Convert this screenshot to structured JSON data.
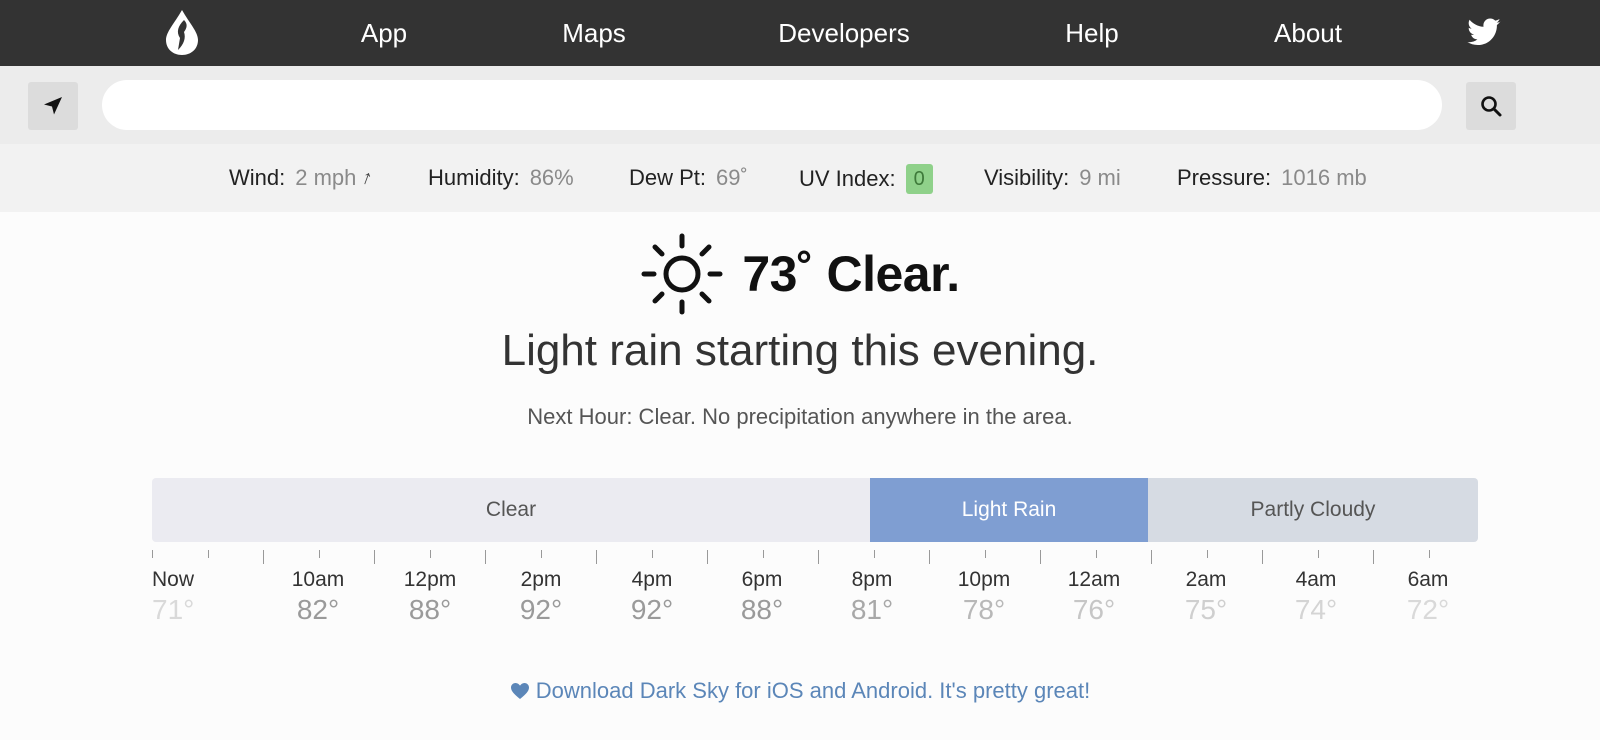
{
  "nav": {
    "logo": "logo-icon",
    "links": [
      "App",
      "Maps",
      "Developers",
      "Help",
      "About"
    ],
    "twitter": "twitter-icon"
  },
  "search": {
    "value": "",
    "location_icon": "location-arrow-icon",
    "search_icon": "search-icon"
  },
  "stats": {
    "wind_label": "Wind:",
    "wind_value": "2 mph",
    "humidity_label": "Humidity:",
    "humidity_value": "86%",
    "dew_label": "Dew Pt:",
    "dew_value": "69˚",
    "uv_label": "UV Index:",
    "uv_value": "0",
    "visibility_label": "Visibility:",
    "visibility_value": "9 mi",
    "pressure_label": "Pressure:",
    "pressure_value": "1016 mb",
    "uv_color": "#8fd18a"
  },
  "current": {
    "icon": "sun-icon",
    "text": "73˚ Clear."
  },
  "summary": "Light rain starting this evening.",
  "next_hour": "Next Hour: Clear. No precipitation anywhere in the area.",
  "timeline": {
    "segments": [
      {
        "label": "Clear",
        "color": "#ebebf1"
      },
      {
        "label": "Light Rain",
        "color": "#7f9ed2"
      },
      {
        "label": "Partly Cloudy",
        "color": "#d6dbe3"
      }
    ],
    "hours": [
      "Now",
      "10am",
      "12pm",
      "2pm",
      "4pm",
      "6pm",
      "8pm",
      "10pm",
      "12am",
      "2am",
      "4am",
      "6am"
    ],
    "temps": [
      "71°",
      "82°",
      "88°",
      "92°",
      "92°",
      "88°",
      "81°",
      "78°",
      "76°",
      "75°",
      "74°",
      "72°"
    ]
  },
  "download": {
    "text": "Download Dark Sky for iOS and Android. It's pretty great!",
    "icon": "heart-icon"
  }
}
